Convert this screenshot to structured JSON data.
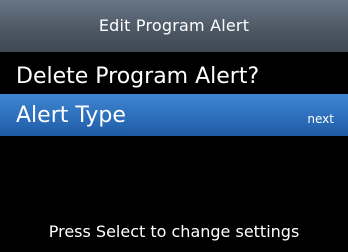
{
  "header": {
    "title": "Edit Program Alert"
  },
  "menu": {
    "items": [
      {
        "label": "Delete Program Alert?",
        "hint": ""
      },
      {
        "label": "Alert Type",
        "hint": "next"
      }
    ]
  },
  "footer": {
    "instruction": "Press Select to change settings"
  },
  "colors": {
    "background": "#000000",
    "title_bar": "#4e5966",
    "highlight": "#2d6fbc",
    "text": "#ffffff"
  }
}
